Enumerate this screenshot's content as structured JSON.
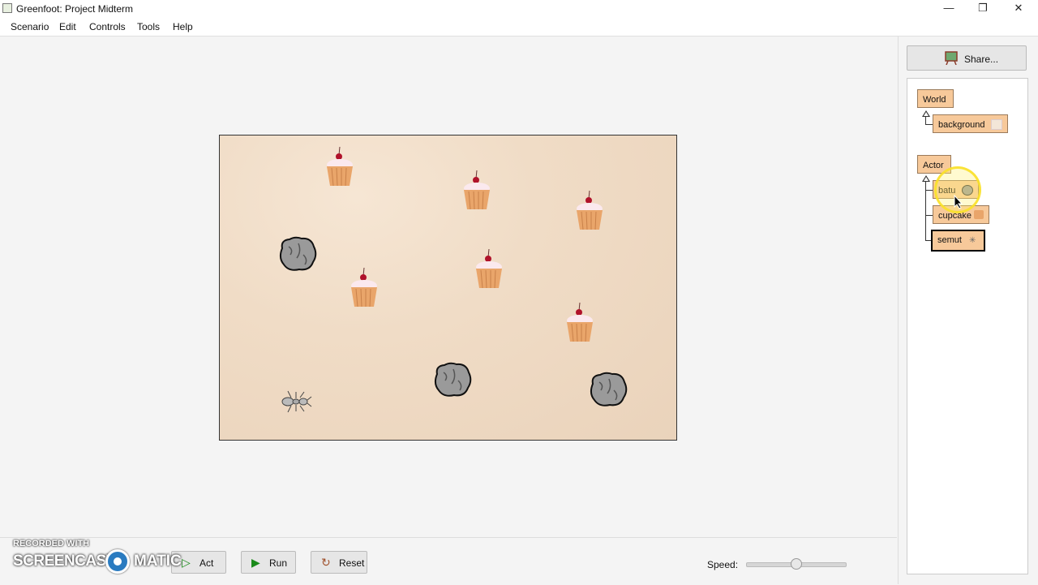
{
  "window": {
    "title": "Greenfoot: Project Midterm",
    "minimize": "—",
    "restore": "❐",
    "close": "✕"
  },
  "menubar": {
    "items": [
      "Scenario",
      "Edit",
      "Controls",
      "Tools",
      "Help"
    ]
  },
  "controls": {
    "act_label": "Act",
    "run_label": "Run",
    "reset_label": "Reset",
    "speed_label": "Speed:",
    "speed_value": 0.5
  },
  "watermark": {
    "line1": "RECORDED WITH",
    "line2a": "SCREENCAST",
    "line2b": "MATIC"
  },
  "share": {
    "label": "Share..."
  },
  "classes": {
    "world": "World",
    "background": "background",
    "actor": "Actor",
    "batu": "batu",
    "cupcake": "cupcake",
    "semut": "semut"
  },
  "colors": {
    "class_box": "#f7c99a",
    "world_bg": "#f0dcc6",
    "run_icon": "#1a8a1a"
  },
  "icons": {
    "act": "play-outline-icon",
    "run": "play-icon",
    "reset": "reset-icon",
    "share": "share-easel-icon"
  }
}
